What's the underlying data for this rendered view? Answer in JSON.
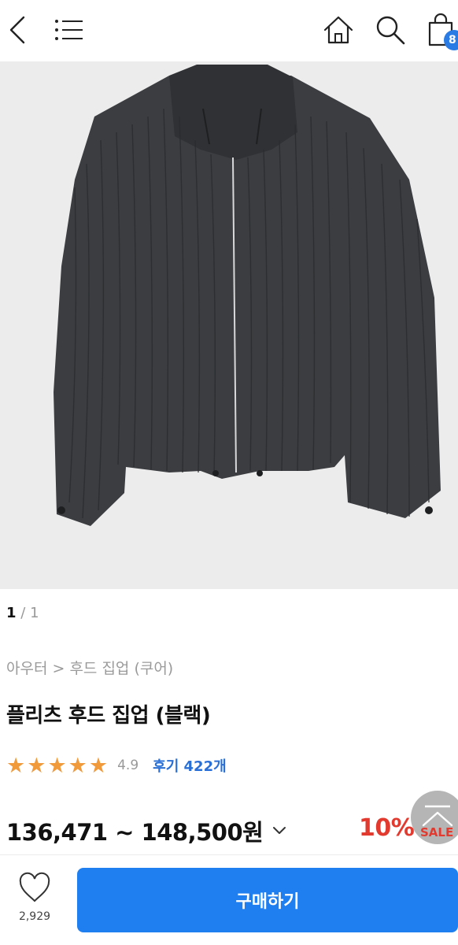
{
  "header": {
    "cart_count": "8"
  },
  "gallery": {
    "current": "1",
    "separator": "/",
    "total": "1"
  },
  "product": {
    "breadcrumb": "아우터 > 후드 집업 (쿠어)",
    "title": "플리츠 후드 집업 (블랙)",
    "rating": {
      "stars": 5,
      "score": "4.9",
      "reviews": "후기 422개"
    },
    "price_range": "136,471 ~ 148,500원",
    "discount": "10%",
    "sale_label": "SALE"
  },
  "footer": {
    "like_count": "2,929",
    "buy_label": "구매하기"
  },
  "icons": {
    "back": "back-arrow-icon",
    "menu": "menu-icon",
    "home": "home-icon",
    "search": "search-icon",
    "bag": "shopping-bag-icon",
    "heart": "heart-icon",
    "scroll_top": "scroll-top-icon",
    "chevron": "chevron-down-icon"
  },
  "colors": {
    "accent": "#1f7ff0",
    "sale": "#e23a2e",
    "star": "#f19a3c",
    "review_link": "#2a6fd6"
  }
}
